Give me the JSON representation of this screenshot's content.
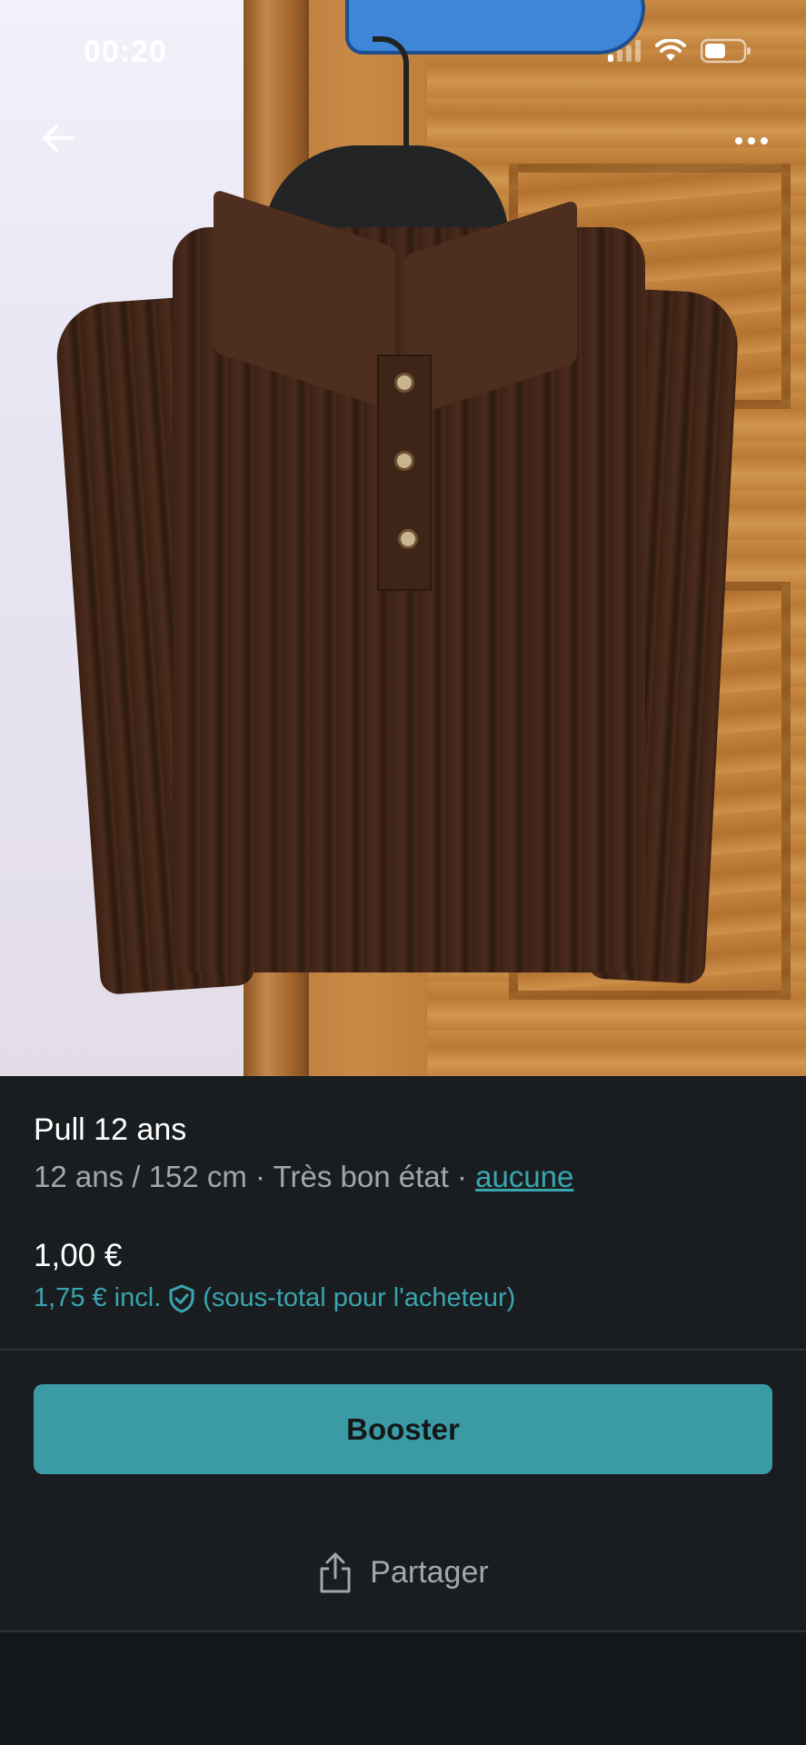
{
  "status_bar": {
    "time": "00:20"
  },
  "nav": {
    "back_icon": "arrow-left-icon",
    "more_icon": "more-horizontal-icon"
  },
  "item": {
    "title": "Pull 12 ans",
    "size": "12 ans / 152 cm",
    "separator": "·",
    "condition": "Très bon état",
    "brand": "aucune",
    "price": "1,00 €",
    "price_incl": "1,75 € incl.",
    "price_incl_note": "(sous-total pour l'acheteur)",
    "protection_icon": "shield-check-icon"
  },
  "actions": {
    "boost_label": "Booster",
    "share_label": "Partager",
    "share_icon": "share-icon"
  },
  "colors": {
    "accent": "#3b9ba5",
    "link": "#3aa5b0",
    "background": "#191d1f",
    "text_primary": "#ffffff",
    "text_secondary": "#a3a7aa"
  }
}
